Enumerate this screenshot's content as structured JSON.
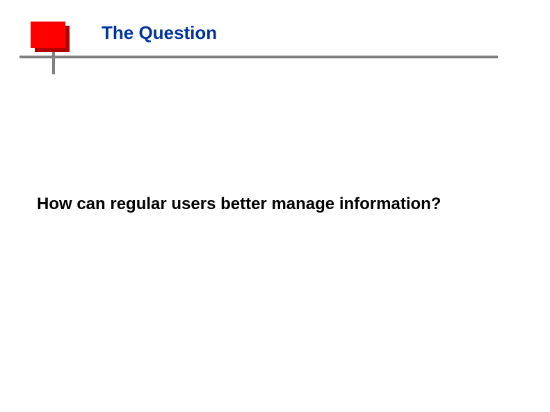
{
  "slide": {
    "title": "The Question",
    "body": "How can regular users better manage information?"
  },
  "theme": {
    "accent_square": "#ff0000",
    "accent_square_shadow": "#b00000",
    "bar_color": "#808080",
    "title_color": "#003399"
  }
}
